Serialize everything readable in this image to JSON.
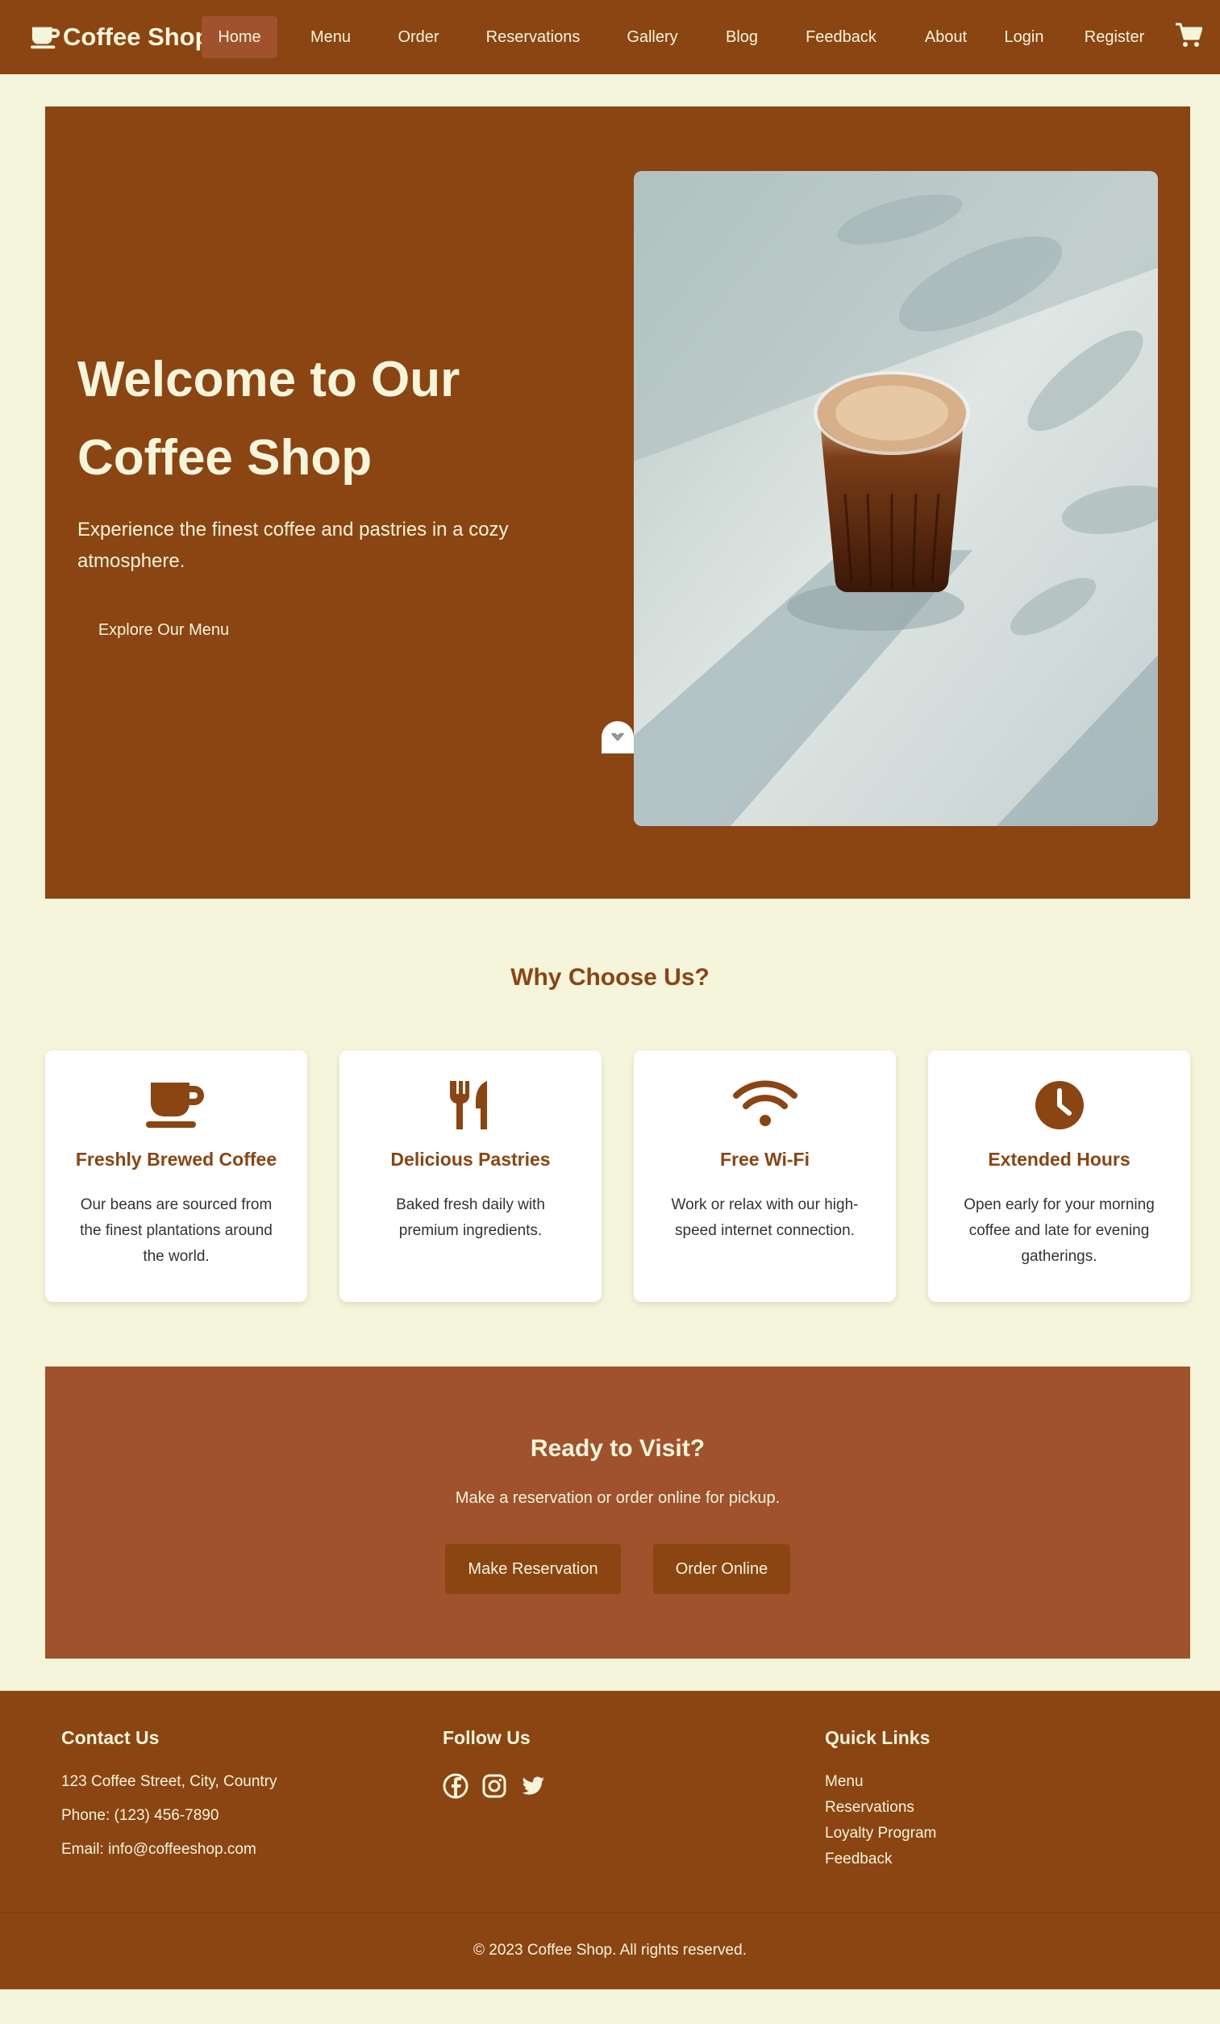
{
  "nav": {
    "brand": "Coffee Shop",
    "links": [
      {
        "label": "Home",
        "active": true
      },
      {
        "label": "Menu",
        "active": false
      },
      {
        "label": "Order",
        "active": false
      },
      {
        "label": "Reservations",
        "active": false
      },
      {
        "label": "Gallery",
        "active": false
      },
      {
        "label": "Blog",
        "active": false
      },
      {
        "label": "Feedback",
        "active": false
      },
      {
        "label": "About",
        "active": false
      },
      {
        "label": "Login",
        "active": false
      },
      {
        "label": "Register",
        "active": false
      }
    ],
    "cart_icon": "shopping-cart-icon"
  },
  "hero": {
    "title": "Welcome to Our Coffee Shop",
    "subtitle": "Experience the finest coffee and pastries in a cozy atmosphere.",
    "button": "Explore Our Menu",
    "scroll_icon": "chevron-down-icon"
  },
  "features": {
    "title": "Why Choose Us?",
    "items": [
      {
        "icon": "coffee-cup-icon",
        "title": "Freshly Brewed Coffee",
        "text": "Our beans are sourced from the finest plantations around the world."
      },
      {
        "icon": "utensils-icon",
        "title": "Delicious Pastries",
        "text": "Baked fresh daily with premium ingredients."
      },
      {
        "icon": "wifi-icon",
        "title": "Free Wi-Fi",
        "text": "Work or relax with our high-speed internet connection."
      },
      {
        "icon": "clock-icon",
        "title": "Extended Hours",
        "text": "Open early for your morning coffee and late for evening gatherings."
      }
    ]
  },
  "cta": {
    "title": "Ready to Visit?",
    "text": "Make a reservation or order online for pickup.",
    "buttons": [
      "Make Reservation",
      "Order Online"
    ]
  },
  "footer": {
    "contact": {
      "title": "Contact Us",
      "address": "123 Coffee Street, City, Country",
      "phone": "Phone: (123) 456-7890",
      "email": "Email: info@coffeeshop.com"
    },
    "follow": {
      "title": "Follow Us",
      "icons": [
        "facebook-icon",
        "instagram-icon",
        "twitter-icon"
      ]
    },
    "quick_links": {
      "title": "Quick Links",
      "links": [
        "Menu",
        "Reservations",
        "Loyalty Program",
        "Feedback"
      ]
    },
    "copyright": "© 2023 Coffee Shop. All rights reserved."
  },
  "colors": {
    "primary": "#8b4513",
    "secondary": "#a0522d",
    "background": "#f5f5dc",
    "text_light": "#f5f5dc"
  }
}
